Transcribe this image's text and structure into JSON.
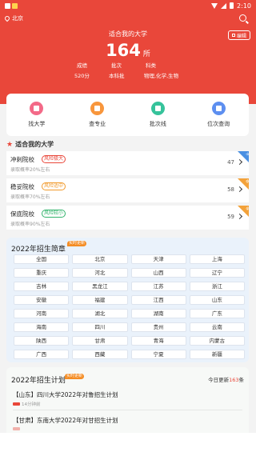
{
  "status_bar": {
    "time": "2:10"
  },
  "header": {
    "location": "北京",
    "edit_label": "编辑",
    "title": "适合我的大学",
    "count": "164",
    "count_unit": "所",
    "labels": [
      "成绩",
      "批次",
      "科类"
    ],
    "values": [
      "520分",
      "本科批",
      "物理,化学,生物"
    ],
    "accent_color": "#e9473a"
  },
  "quick_actions": [
    {
      "label": "找大学",
      "icon": "school-icon"
    },
    {
      "label": "查专业",
      "icon": "book-icon"
    },
    {
      "label": "批次线",
      "icon": "graduation-cap-icon"
    },
    {
      "label": "位次查询",
      "icon": "ranking-icon"
    }
  ],
  "suitable": {
    "title": "适合我的大学",
    "items": [
      {
        "name": "冲刺院校",
        "tag": "风险极大",
        "sub": "录取概率20%左右",
        "count": "47",
        "corner": "冲"
      },
      {
        "name": "稳妥院校",
        "tag": "风险适中",
        "sub": "录取概率70%左右",
        "count": "58",
        "corner": "稳"
      },
      {
        "name": "保底院校",
        "tag": "风险较小",
        "sub": "录取概率90%左右",
        "count": "59",
        "corner": "保"
      }
    ]
  },
  "brochure": {
    "title": "2022年招生简章",
    "badge": "实时更新",
    "provinces": [
      "全国",
      "北京",
      "天津",
      "上海",
      "重庆",
      "河北",
      "山西",
      "辽宁",
      "吉林",
      "黑龙江",
      "江苏",
      "浙江",
      "安徽",
      "福建",
      "江西",
      "山东",
      "河南",
      "湖北",
      "湖南",
      "广东",
      "海南",
      "四川",
      "贵州",
      "云南",
      "陕西",
      "甘肃",
      "青海",
      "内蒙古",
      "广西",
      "西藏",
      "宁夏",
      "新疆"
    ]
  },
  "plan": {
    "title": "2022年招生计划",
    "badge": "实时更新",
    "today_prefix": "今日更新",
    "today_count": "163",
    "today_suffix": "条",
    "items": [
      {
        "title": "【山东】四川大学2022年对鲁招生计划",
        "meta": "14分钟前"
      },
      {
        "title": "【甘肃】东南大学2022年对甘招生计划",
        "meta": ""
      }
    ]
  }
}
